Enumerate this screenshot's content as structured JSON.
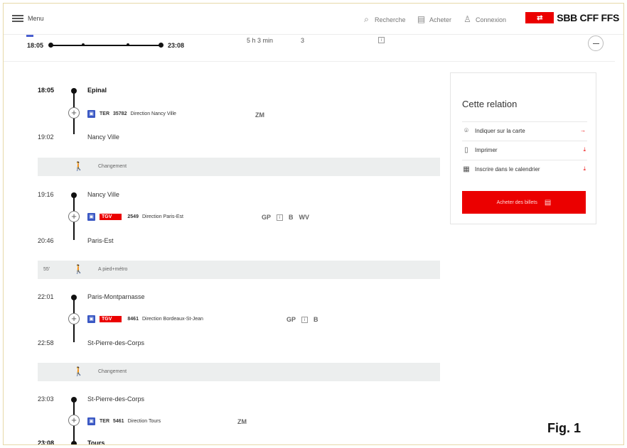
{
  "header": {
    "menu_label": "Menu",
    "search_label": "Recherche",
    "buy_label": "Acheter",
    "login_label": "Connexion",
    "logo_text": "SBB CFF FFS"
  },
  "summary": {
    "departure": "18:05",
    "arrival": "23:08",
    "duration": "5 h 3 min",
    "changes": "3"
  },
  "segments": [
    {
      "dep_time": "18:05",
      "dep_stop": "Epinal",
      "train_type": "TER",
      "train_number": "35782",
      "direction": "Direction Nancy Ville",
      "attrs": "ZM",
      "arr_time": "19:02",
      "arr_stop": "Nancy Ville"
    },
    {
      "dep_time": "19:16",
      "dep_stop": "Nancy Ville",
      "train_badge": "TGV",
      "train_number": "2549",
      "direction": "Direction Paris-Est",
      "attrs": [
        "GP",
        "B",
        "WV"
      ],
      "arr_time": "20:46",
      "arr_stop": "Paris-Est"
    },
    {
      "dep_time": "22:01",
      "dep_stop": "Paris-Montparnasse",
      "train_badge": "TGV",
      "train_number": "8461",
      "direction": "Direction Bordeaux-St-Jean",
      "attrs": [
        "GP",
        "B"
      ],
      "arr_time": "22:58",
      "arr_stop": "St-Pierre-des-Corps"
    },
    {
      "dep_time": "23:03",
      "dep_stop": "St-Pierre-des-Corps",
      "train_type": "TER",
      "train_number": "5461",
      "direction": "Direction Tours",
      "attrs": "ZM",
      "arr_time": "23:08",
      "arr_stop": "Tours"
    }
  ],
  "transfers": [
    {
      "duration": "",
      "label": "Changement"
    },
    {
      "duration": "55'",
      "label": "A pied+métro"
    },
    {
      "duration": "",
      "label": "Changement"
    }
  ],
  "panel": {
    "title": "Cette relation",
    "map_label": "Indiquer sur la carte",
    "print_label": "Imprimer",
    "calendar_label": "Inscrire dans le calendrier",
    "buy_button": "Acheter des billets"
  },
  "figure_label": "Fig. 1",
  "colors": {
    "brand_red": "#eb0000",
    "train_blue": "#3a58c4"
  }
}
